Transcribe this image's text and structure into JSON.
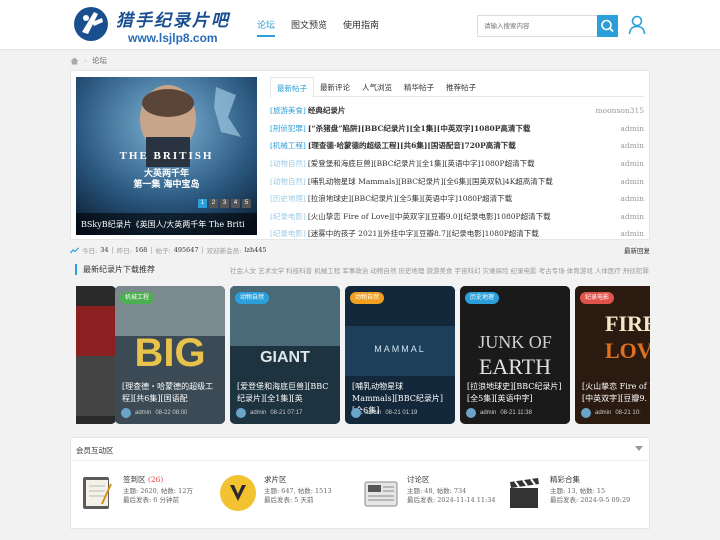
{
  "site": {
    "title": "猎手纪录片吧",
    "url": "www.lsjlp8.com"
  },
  "nav": [
    "论坛",
    "图文预览",
    "使用指南"
  ],
  "search": {
    "placeholder": "请输入搜索内容"
  },
  "breadcrumb": {
    "current": "论坛"
  },
  "banner": {
    "title_en": "THE BRITISH",
    "title_cn_1": "大英两千年",
    "title_cn_2": "第一集  海中宝岛",
    "caption": "BSkyB纪录片《英国人/大英两千年 The Briti",
    "pages": [
      "1",
      "2",
      "3",
      "4",
      "5"
    ],
    "active_page": 1
  },
  "tabs": [
    "最新帖子",
    "最新评论",
    "人气浏览",
    "精华帖子",
    "推荐帖子"
  ],
  "posts": [
    {
      "tag": "[旅游美食]",
      "title": "经典纪录片",
      "author": "moonson315",
      "bold": true,
      "muted": false
    },
    {
      "tag": "[刑侦犯罪]",
      "title": "[“杀猪盘”陷阱][BBC纪录片][全1集][中英双字]1080P高清下载",
      "author": "admin",
      "bold": true,
      "muted": false
    },
    {
      "tag": "[机械工程]",
      "title": "[理查德·哈蒙德的超级工程][共6集][国语配音]720P高清下载",
      "author": "admin",
      "bold": true,
      "muted": false
    },
    {
      "tag": "[动物自然]",
      "title": "[爱登堡和海底巨兽][BBC纪录片][全1集][英语中字]1080P超清下载",
      "author": "admin",
      "bold": false,
      "muted": true
    },
    {
      "tag": "[动物自然]",
      "title": "[哺乳动物星球 Mammals][BBC纪录片][全6集][国英双轨]4K超高清下载",
      "author": "admin",
      "bold": false,
      "muted": true
    },
    {
      "tag": "[历史地理]",
      "title": "[拉浪地球史][BBC纪录片][全5集][英语中字]1080P超清下载",
      "author": "admin",
      "bold": false,
      "muted": true
    },
    {
      "tag": "[纪录电影]",
      "title": "[火山挚恋 Fire of Love][中英双字][豆瓣9.0][纪录电影]1080P超清下载",
      "author": "admin",
      "bold": false,
      "muted": true
    },
    {
      "tag": "[纪录电影]",
      "title": "[迷雾中的孩子 2021][外挂中字][豆瓣8.7][纪录电影]1080P超清下载",
      "author": "admin",
      "bold": false,
      "muted": true
    }
  ],
  "stats": {
    "today_label": "今日:",
    "today": "34",
    "yesterday_label": "昨日:",
    "yesterday": "168",
    "posts_label": "帖子:",
    "posts": "495647",
    "welcome_label": "欢迎新会员:",
    "new_member": "lzh445",
    "latest_reply": "最新回复"
  },
  "recommend": {
    "title": "最新纪录片下载推荐",
    "categories": "社会人文 艺术文学 科技科普 机械工程 军事政治 动物自然 历史地理 旅游美食 宇宙科幻 灾难探险 纪录电影 考古专场 体育游戏 人体医疗 刑侦犯罪"
  },
  "cards": [
    {
      "badge": "",
      "title": "",
      "author": "",
      "date": ""
    },
    {
      "badge": "机械工程",
      "title": "[理查德・哈蒙德的超级工程][共6集][国语配",
      "author": "admin",
      "date": "08-22 08:00"
    },
    {
      "badge": "动物自然",
      "title": "[爱登堡和海底巨兽][BBC纪录片][全1集][英",
      "author": "admin",
      "date": "08-21 07:17"
    },
    {
      "badge": "动物自然",
      "title": "[哺乳动物星球 Mammals][BBC纪录片][全6集]",
      "author": "admin",
      "date": "08-21 01:19"
    },
    {
      "badge": "历史地理",
      "title": "[拉浪地球史][BBC纪录片][全5集][英语中字]",
      "author": "admin",
      "date": "08-21 11:38"
    },
    {
      "badge": "纪录电影",
      "title": "[火山挚恋 Fire of Love][中英双字][豆瓣9.",
      "author": "admin",
      "date": "08-21 10:"
    }
  ],
  "card_text": {
    "sign": "FIRE OF",
    "fire_sub": "LOVE",
    "sign2": "JUNK OF",
    "earth": "EARTH",
    "big": "BIG",
    "giant": "GIANT",
    "mammal": "MAMMAL"
  },
  "forum": {
    "title": "会员互动区",
    "items": [
      {
        "name": "签到区",
        "today": "(26)",
        "line1": "主题: 2620, 帖数: 12万",
        "line2": "最后发表: 6 分钟前"
      },
      {
        "name": "求片区",
        "today": "",
        "line1": "主题: 647, 帖数: 1513",
        "line2": "最后发表: 5 天前"
      },
      {
        "name": "讨论区",
        "today": "",
        "line1": "主题: 48, 帖数: 734",
        "line2": "最后发表: 2024-11-14 11:34"
      },
      {
        "name": "精彩合集",
        "today": "",
        "line1": "主题: 13, 帖数: 15",
        "line2": "最后发表: 2024-9-5 09:29"
      }
    ]
  },
  "colors": {
    "accent": "#2b9fd9",
    "brand": "#1a4f8f"
  }
}
